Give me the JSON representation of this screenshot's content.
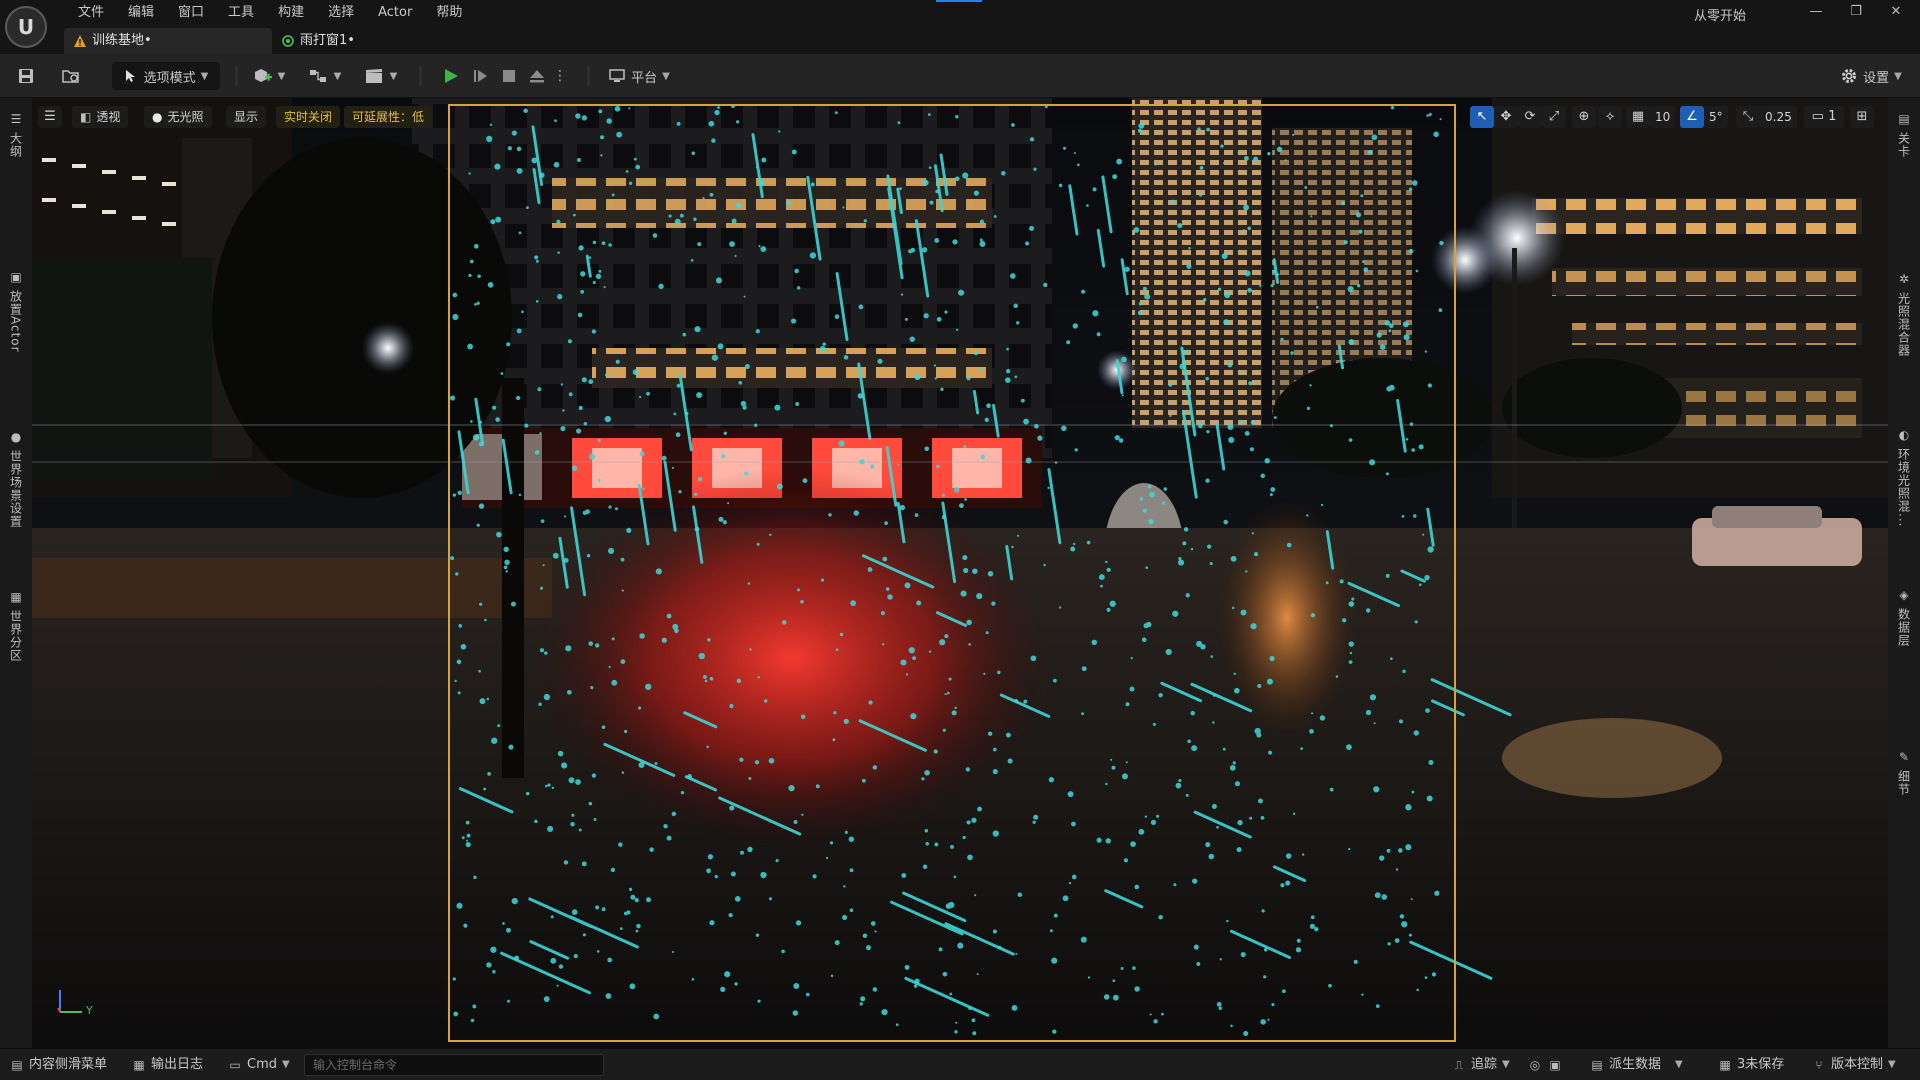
{
  "window": {
    "menus": [
      "文件",
      "编辑",
      "窗口",
      "工具",
      "构建",
      "选择",
      "Actor",
      "帮助"
    ],
    "start_link": "从零开始",
    "controls": {
      "minimize": "—",
      "maximize": "❐",
      "close": "✕"
    }
  },
  "tabs": [
    {
      "label": "训练基地•",
      "icon": "level-warning-icon"
    },
    {
      "label": "雨打窗1•",
      "icon": "material-icon"
    }
  ],
  "toolbar": {
    "mode_label": "选项模式",
    "platform_label": "平台",
    "settings_label": "设置"
  },
  "left_rail": [
    "大纲",
    "放置Actor",
    "世界场景设置",
    "世界分区"
  ],
  "right_rail": [
    "关卡",
    "光照混合器",
    "环境光照混...",
    "数据层",
    "细节"
  ],
  "viewport": {
    "perspective_label": "透视",
    "lighting_label": "无光照",
    "show_label": "显示",
    "realtime_label": "实时关闭",
    "scalability_label": "可延展性：低",
    "grid_snap_value": "10",
    "rotation_snap_value": "5°",
    "scale_snap_value": "0.25",
    "camera_speed_value": "1",
    "axis_label": "Y"
  },
  "statusbar": {
    "content_drawer": "内容侧滑菜单",
    "output_log": "输出日志",
    "cmd_label": "Cmd",
    "cmd_placeholder": "输入控制台命令",
    "trace_label": "追踪",
    "derived_data_label": "派生数据",
    "unsaved_label": "3未保存",
    "source_control_label": "版本控制"
  },
  "colors": {
    "accent_blue": "#1e5fb5",
    "selection_outline": "#d6a53a",
    "play_green": "#3fb24a",
    "scalability_warning": "#e4c04a"
  }
}
